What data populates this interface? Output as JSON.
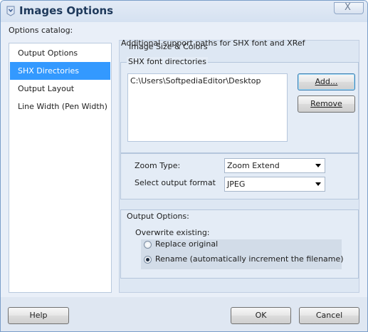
{
  "window": {
    "title": "Images Options",
    "close_glyph": "X"
  },
  "catalog": {
    "label": "Options catalog:",
    "items": [
      "Output Options",
      "SHX Directories",
      "Output Layout",
      "Line Width (Pen Width)"
    ]
  },
  "panel": {
    "behind_label": "Image Size & Colors",
    "front_label": "Additional support paths for SHX font and XRef",
    "shx_group_label": "SHX font directories",
    "shx_paths": [
      "C:\\Users\\SoftpediaEditor\\Desktop"
    ],
    "add_button": "Add...",
    "remove_button": "Remove",
    "zoom_type_label": "Zoom Type:",
    "zoom_type_value": "Zoom Extend",
    "output_format_label": "Select output format",
    "output_format_value": "JPEG",
    "output_options_label": "Output Options:",
    "overwrite_label": "Overwrite existing:",
    "radio_replace": "Replace original",
    "radio_rename": "Rename (automatically increment the filename)"
  },
  "footer": {
    "help_button": "Help",
    "ok_button": "OK",
    "cancel_button": "Cancel"
  }
}
